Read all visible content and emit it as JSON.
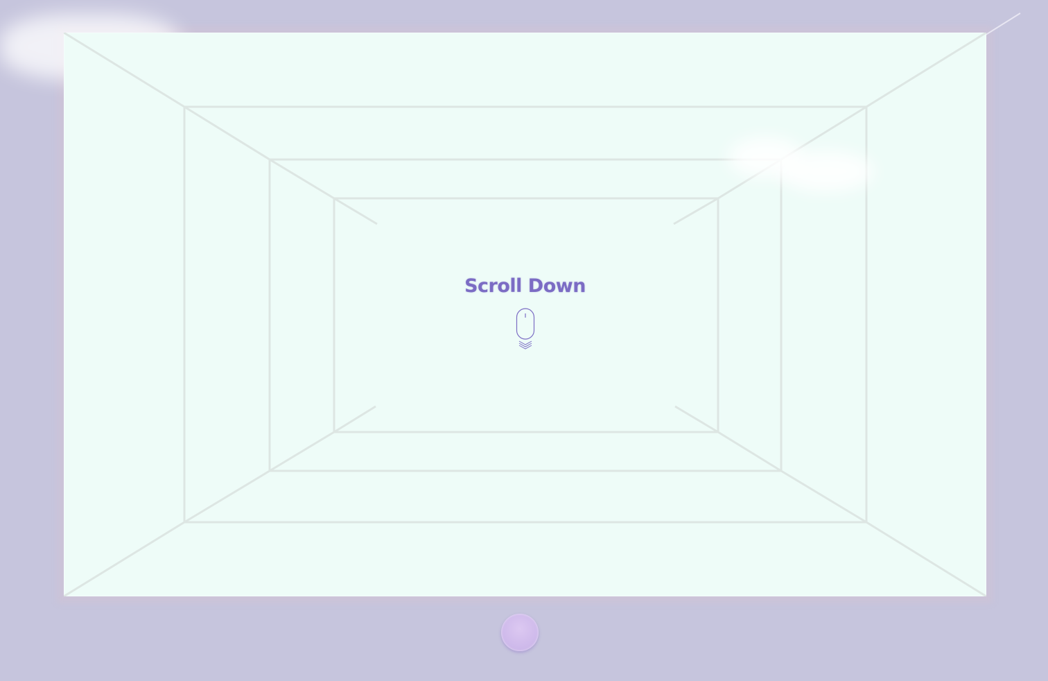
{
  "prompt": {
    "title": "Scroll Down",
    "icon": "mouse-scroll-icon"
  },
  "home_button": {
    "icon": "home-button"
  },
  "colors": {
    "background": "#c6c5dd",
    "screen": "#eefcf8",
    "accent": "#7b6cc4",
    "button": "#cdb8ea"
  }
}
